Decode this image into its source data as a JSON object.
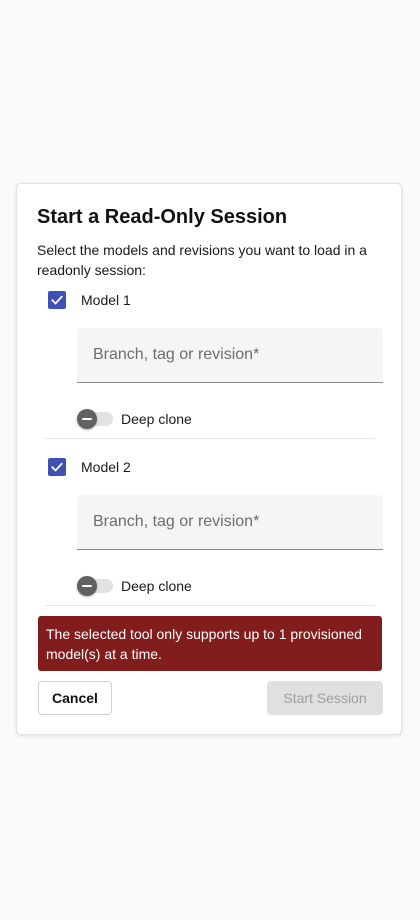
{
  "dialog": {
    "title": "Start a Read-Only Session",
    "description": "Select the models and revisions you want to load in a readonly session:"
  },
  "models": [
    {
      "label": "Model 1",
      "checked": true,
      "revision_value": "",
      "revision_placeholder": "Branch, tag or revision*",
      "deep_clone_label": "Deep clone",
      "deep_clone_on": false
    },
    {
      "label": "Model 2",
      "checked": true,
      "revision_value": "",
      "revision_placeholder": "Branch, tag or revision*",
      "deep_clone_label": "Deep clone",
      "deep_clone_on": false
    }
  ],
  "error_message": "The selected tool only supports up to 1 provisioned model(s) at a time.",
  "actions": {
    "cancel_label": "Cancel",
    "start_label": "Start Session",
    "start_disabled": true
  },
  "colors": {
    "checkbox_accent": "#3f51b5",
    "error_background": "#821d1d",
    "disabled_button": "#e0e0e0"
  },
  "icons": [
    "check-icon",
    "minus-icon"
  ]
}
